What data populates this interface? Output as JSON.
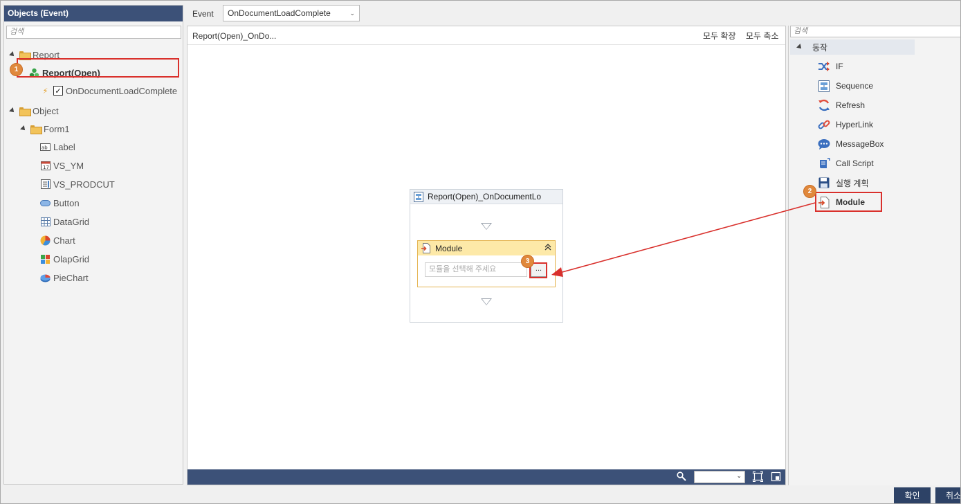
{
  "left_panel": {
    "title": "Objects (Event)",
    "search_placeholder": "검색",
    "tree": {
      "report_folder": "Report",
      "report_open": "Report(Open)",
      "event_item": "OnDocumentLoadComplete",
      "object_folder": "Object",
      "form_folder": "Form1",
      "items": [
        "Label",
        "VS_YM",
        "VS_PRODCUT",
        "Button",
        "DataGrid",
        "Chart",
        "OlapGrid",
        "PieChart"
      ]
    }
  },
  "event_bar": {
    "label": "Event",
    "selected": "OnDocumentLoadComplete"
  },
  "canvas": {
    "title": "Report(Open)_OnDo...",
    "expand_all": "모두 확장",
    "collapse_all": "모두 축소",
    "flow_card_title": "Report(Open)_OnDocumentLo",
    "module_title": "Module",
    "module_placeholder": "모듈을 선택해 주세요",
    "module_button": "..."
  },
  "right_panel": {
    "search_placeholder": "검색",
    "group": "동작",
    "actions": [
      "IF",
      "Sequence",
      "Refresh",
      "HyperLink",
      "MessageBox",
      "Call Script",
      "실행 계획",
      "Module"
    ]
  },
  "badges": [
    "1",
    "2",
    "3"
  ],
  "footer": {
    "ok": "확인",
    "cancel": "취소"
  },
  "colors": {
    "header_navy": "#3c5178",
    "highlight_red": "#d9302c",
    "badge_orange": "#e0883c"
  }
}
